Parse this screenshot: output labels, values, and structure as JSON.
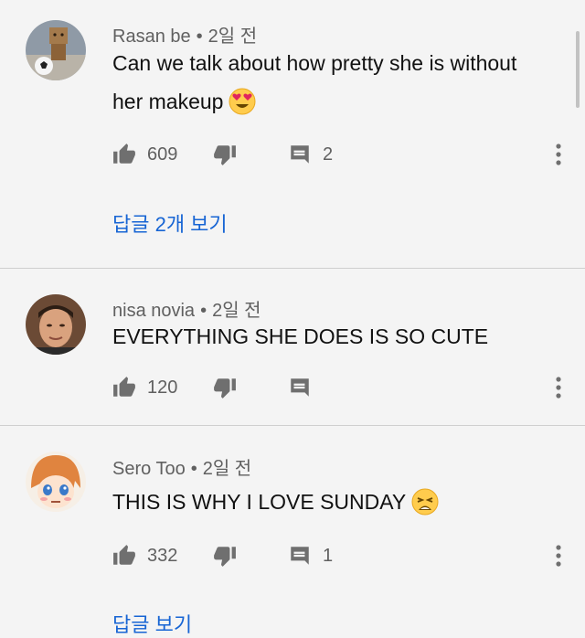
{
  "comments": [
    {
      "author": "Rasan be",
      "time": "2일 전",
      "text_line1": "Can we talk about how pretty she is without",
      "text_line2": "her makeup",
      "emoji": "heart-eyes-emoji",
      "likes": "609",
      "reply_count": "2",
      "replies_link": "답글 2개 보기"
    },
    {
      "author": "nisa novia",
      "time": "2일 전",
      "text_line1": "EVERYTHING SHE DOES IS SO CUTE",
      "likes": "120"
    },
    {
      "author": "Sero Too",
      "time": "2일 전",
      "text_line1": "THIS IS WHY I LOVE SUNDAY",
      "emoji": "weary-face-emoji",
      "likes": "332",
      "reply_count": "1",
      "replies_link": "답글 보기"
    }
  ],
  "separator": "•",
  "icons": {
    "like": "thumbs-up-icon",
    "dislike": "thumbs-down-icon",
    "reply": "comment-icon",
    "more": "more-vert-icon"
  },
  "colors": {
    "background": "#f4f4f4",
    "link": "#1765d4",
    "secondary_text": "#606060",
    "icon": "#6f6f6f"
  }
}
